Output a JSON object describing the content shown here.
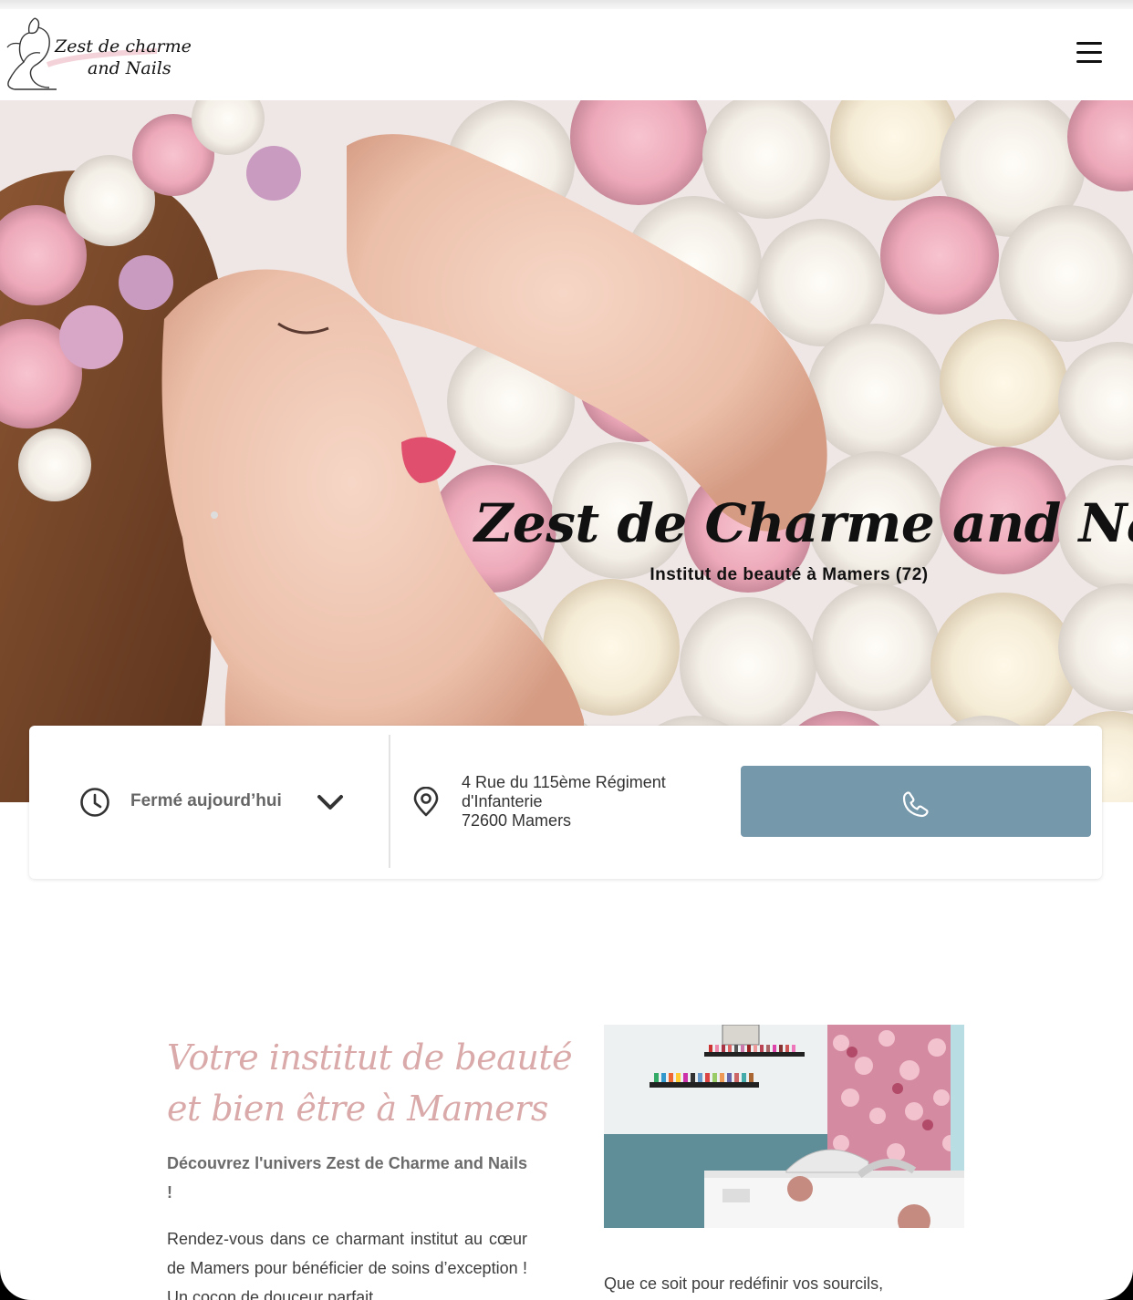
{
  "header": {
    "logo_line1": "Zest de charme",
    "logo_line2": "and Nails",
    "menu_icon": "hamburger-menu-icon"
  },
  "hero": {
    "title": "Zest de Charme and Nails",
    "subtitle": "Institut de beauté à Mamers (72)"
  },
  "info": {
    "hours_status": "Fermé aujourd’hui",
    "hours_icon": "clock-icon",
    "toggle_icon": "chevron-down-icon",
    "address_icon": "map-pin-icon",
    "address_line1": "4 Rue du 115ème Régiment",
    "address_line2": "d'Infanterie",
    "address_line3": "72600 Mamers",
    "call_icon": "phone-icon",
    "call_button_color": "#7698ab"
  },
  "intro": {
    "heading_line1": "Votre institut de beauté",
    "heading_line2": "et bien être à Mamers",
    "heading_color": "#d9aaa9",
    "lead": "Découvrez l'univers Zest de Charme and Nails !",
    "body": "Rendez-vous dans ce charmant institut au cœur de Mamers pour bénéficier de soins d’exception ! Un cocon de douceur parfait",
    "right_text": "Que ce soit pour redéfinir vos sourcils,"
  }
}
